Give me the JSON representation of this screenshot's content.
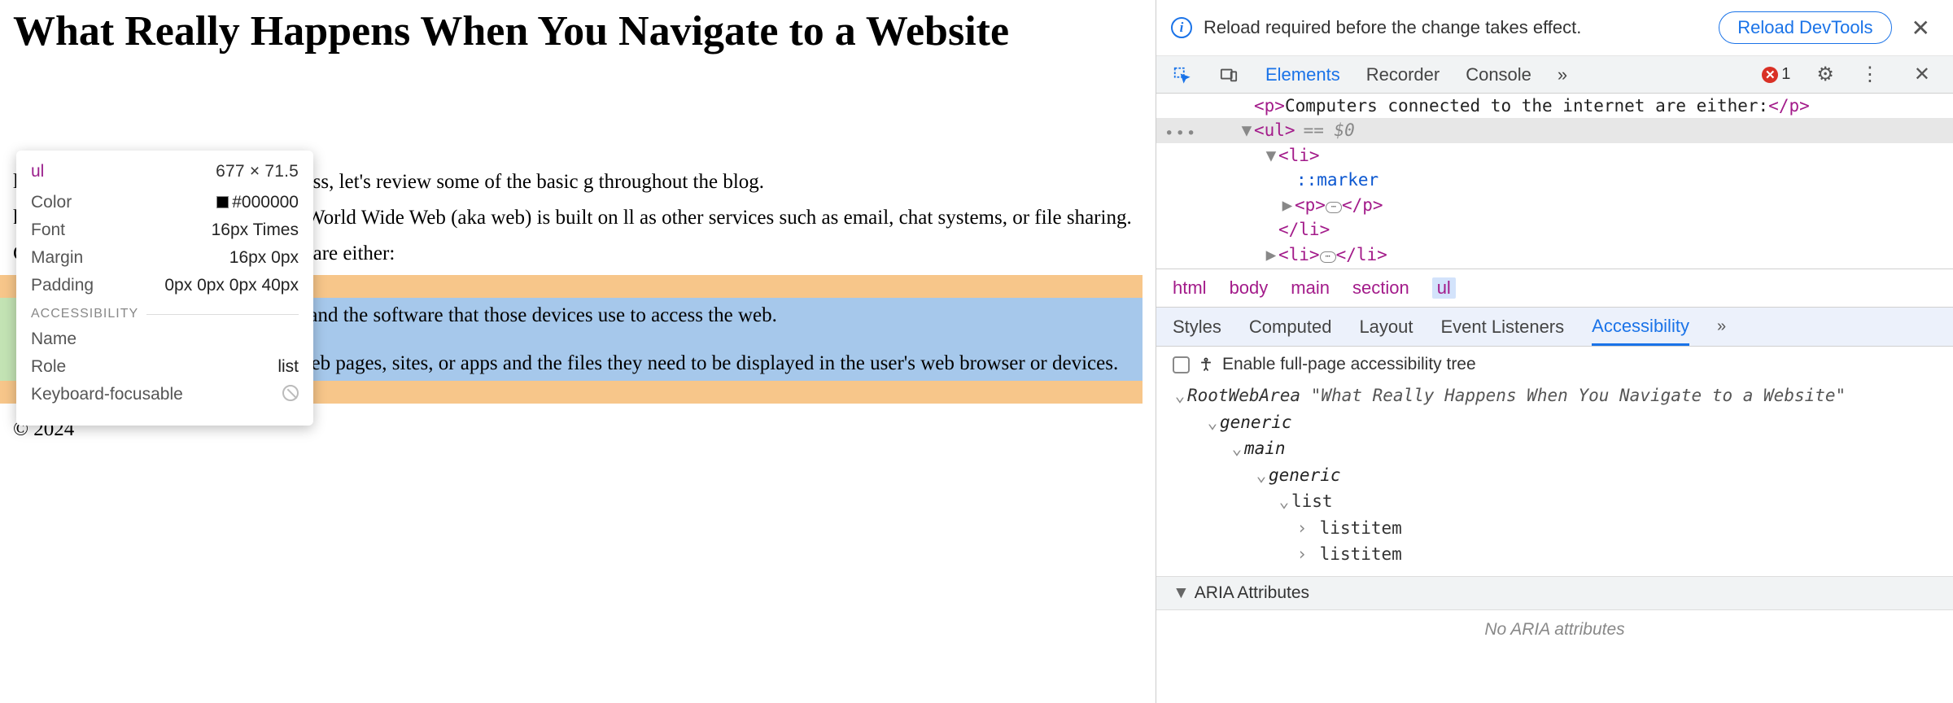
{
  "page": {
    "title": "What Really Happens When You Navigate to a Website",
    "intro1": "ls of every step included in the process, let's review some of the basic g throughout the blog.",
    "intro2": "k of interconnected computers. The World Wide Web (aka web) is built on ll as other services such as email, chat systems, or file sharing.",
    "p_either": "Computers connected to the internet are either:",
    "bullets": [
      "Clients, the web user's devices and the software that those devices use to access the web.",
      "Servers, computers that store web pages, sites, or apps and the files they need to be displayed in the user's web browser or devices."
    ],
    "copyright": "© 2024"
  },
  "tooltip": {
    "tag": "ul",
    "dimensions": "677 × 71.5",
    "rows": {
      "color_label": "Color",
      "color_value": "#000000",
      "font_label": "Font",
      "font_value": "16px Times",
      "margin_label": "Margin",
      "margin_value": "16px 0px",
      "padding_label": "Padding",
      "padding_value": "0px 0px 0px 40px"
    },
    "section": "ACCESSIBILITY",
    "a11y": {
      "name_label": "Name",
      "name_value": "",
      "role_label": "Role",
      "role_value": "list",
      "kf_label": "Keyboard-focusable"
    }
  },
  "devtools": {
    "banner": {
      "text": "Reload required before the change takes effect.",
      "button": "Reload DevTools"
    },
    "tabs": {
      "elements": "Elements",
      "recorder": "Recorder",
      "console": "Console",
      "more": "»",
      "error_count": "1"
    },
    "dom": {
      "line_p": "<p>Computers connected to the internet are either:</p>",
      "ul_open": "<ul>",
      "eq0": "== $0",
      "li_open": "<li>",
      "marker": "::marker",
      "p_ellipsis_open": "<p>",
      "p_ellipsis_close": "</p>",
      "li_close": "</li>",
      "li2_open": "<li>",
      "li2_close": "</li>"
    },
    "breadcrumb": [
      "html",
      "body",
      "main",
      "section",
      "ul"
    ],
    "subtabs": {
      "styles": "Styles",
      "computed": "Computed",
      "layout": "Layout",
      "event": "Event Listeners",
      "a11y": "Accessibility",
      "more": "»"
    },
    "a11y": {
      "enable_label": "Enable full-page accessibility tree",
      "root": "RootWebArea",
      "root_title": "\"What Really Happens When You Navigate to a Website\"",
      "generic": "generic",
      "main": "main",
      "list": "list",
      "listitem": "listitem",
      "aria_header": "ARIA Attributes",
      "aria_empty": "No ARIA attributes"
    }
  }
}
